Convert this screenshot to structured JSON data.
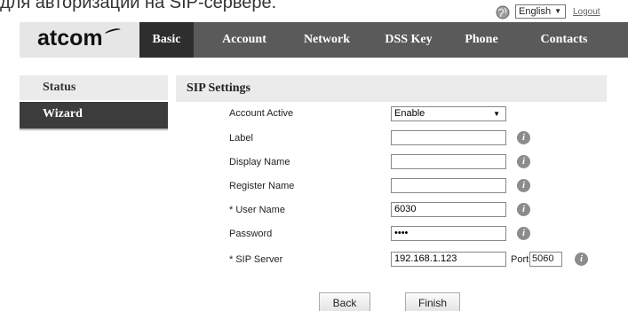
{
  "caption": "для авторизации на SIP-сервере.",
  "header": {
    "language": "English",
    "logout": "Logout"
  },
  "logo": "atcom",
  "nav": {
    "tabs": [
      "Basic",
      "Account",
      "Network",
      "DSS Key",
      "Phone",
      "Contacts"
    ],
    "active": "Basic"
  },
  "sidebar": {
    "items": [
      "Status",
      "Wizard"
    ],
    "active": "Wizard"
  },
  "panel": {
    "title": "SIP Settings",
    "fields": {
      "account_active": {
        "label": "Account Active",
        "value": "Enable"
      },
      "label": {
        "label": "Label",
        "value": ""
      },
      "display_name": {
        "label": "Display Name",
        "value": ""
      },
      "register_name": {
        "label": "Register Name",
        "value": ""
      },
      "user_name": {
        "label": "* User Name",
        "value": "6030"
      },
      "password": {
        "label": "Password",
        "value": "••••"
      },
      "sip_server": {
        "label": "* SIP Server",
        "value": "192.168.1.123"
      }
    },
    "port": {
      "label": "Port",
      "value": "5060"
    },
    "info_glyph": "i"
  },
  "buttons": {
    "back": "Back",
    "finish": "Finish"
  },
  "colors": {
    "nav_bg": "#5a5a5a",
    "nav_active": "#2e2e2e",
    "sidebar_active": "#3c3c3c",
    "panel_header": "#ebebeb",
    "info_icon": "#8c8c8c"
  }
}
